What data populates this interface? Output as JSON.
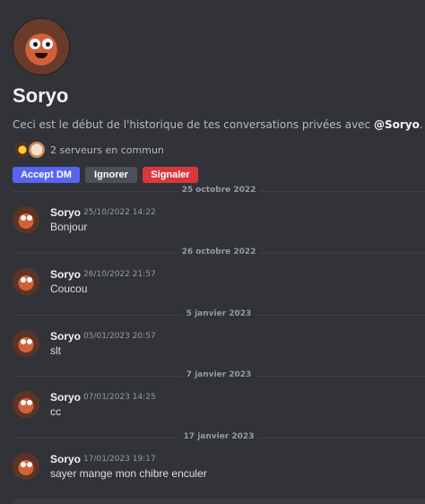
{
  "profile": {
    "username": "Soryo",
    "intro_prefix": "Ceci est le début de l'historique de tes conversations privées avec ",
    "intro_mention": "@Soryo",
    "intro_suffix": ".",
    "mutual_servers": "2 serveurs en commun",
    "actions": {
      "accept": "Accept DM",
      "ignore": "Ignorer",
      "report": "Signaler"
    }
  },
  "dividers": [
    "25 octobre 2022",
    "26 octobre 2022",
    "5 janvier 2023",
    "7 janvier 2023",
    "17 janvier 2023"
  ],
  "messages": [
    {
      "author": "Soryo",
      "time": "25/10/2022 14:22",
      "text": "Bonjour"
    },
    {
      "author": "Soryo",
      "time": "26/10/2022 21:57",
      "text": "Coucou"
    },
    {
      "author": "Soryo",
      "time": "05/01/2023 20:57",
      "text": "slt"
    },
    {
      "author": "Soryo",
      "time": "07/01/2023 14:25",
      "text": "cc"
    },
    {
      "author": "Soryo",
      "time": "17/01/2023 19:17",
      "text": "sayer mange mon chibre enculer"
    }
  ],
  "colors": {
    "background": "#313338",
    "accept": "#5865f2",
    "ignore": "#4e5058",
    "report": "#da373c"
  }
}
